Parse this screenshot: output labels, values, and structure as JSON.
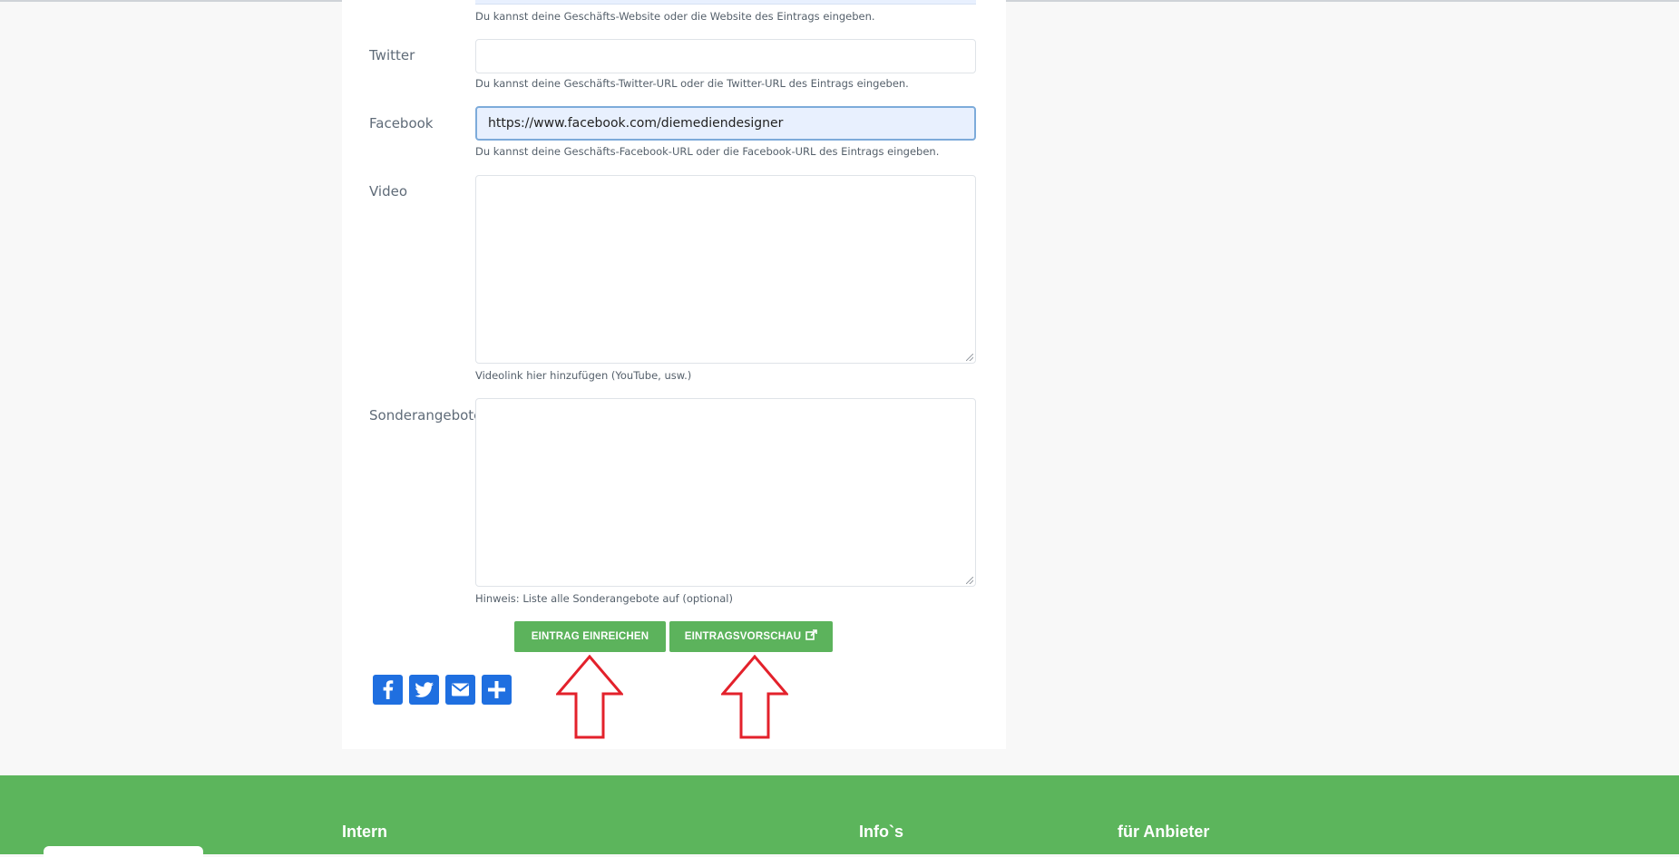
{
  "form": {
    "website_help": "Du kannst deine Geschäfts-Website oder die Website des Eintrags eingeben.",
    "twitter": {
      "label": "Twitter",
      "value": "",
      "help": "Du kannst deine Geschäfts-Twitter-URL oder die Twitter-URL des Eintrags eingeben."
    },
    "facebook": {
      "label": "Facebook",
      "value": "https://www.facebook.com/diemediendesigner",
      "help": "Du kannst deine Geschäfts-Facebook-URL oder die Facebook-URL des Eintrags eingeben."
    },
    "video": {
      "label": "Video",
      "value": "",
      "help": "Videolink hier hinzufügen (YouTube, usw.)"
    },
    "specials": {
      "label": "Sonderangebote",
      "value": "",
      "help": "Hinweis: Liste alle Sonderangebote auf (optional)"
    }
  },
  "actions": {
    "submit_label": "EINTRAG EINREICHEN",
    "preview_label": "EINTRAGSVORSCHAU"
  },
  "share": {
    "icons": [
      "facebook-icon",
      "twitter-icon",
      "email-icon",
      "share-plus-icon"
    ]
  },
  "footer": {
    "col1": "Intern",
    "col2": "Info`s",
    "col3": "für Anbieter"
  },
  "colors": {
    "button_green": "#5cb35c",
    "footer_green": "#5cb55c",
    "share_blue": "#1f6fe0",
    "annotation_red": "#e3212b"
  }
}
